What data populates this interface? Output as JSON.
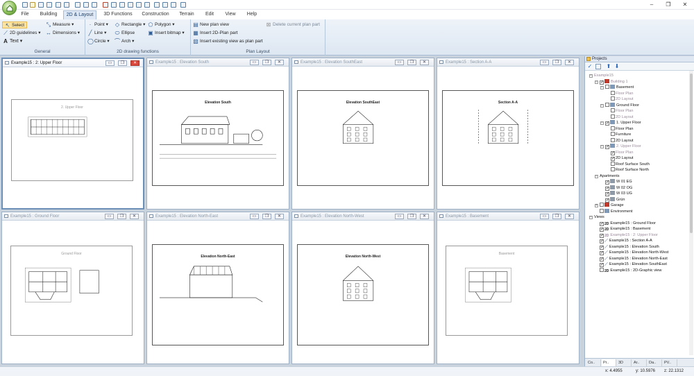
{
  "app": {
    "quick_access_icons": [
      "logo-icon",
      "new-icon",
      "open-icon",
      "save-icon",
      "undo-icon",
      "redo-icon",
      "2d-view-icon",
      "3d-view-icon",
      "paste-icon",
      "copy-icon",
      "print-icon",
      "tools-icon"
    ],
    "window_controls": {
      "minimize": "–",
      "restore": "❐",
      "close": "✕"
    }
  },
  "tabs": [
    "File",
    "Building",
    "2D & Layout",
    "3D Functions",
    "Construction",
    "Terrain",
    "Edit",
    "View",
    "Help"
  ],
  "active_tab": "2D & Layout",
  "ribbon": {
    "general": {
      "label": "General",
      "select": "Select",
      "guidelines": "2D guidelines",
      "text": "Text",
      "measure": "Measure",
      "dimensions": "Dimensions"
    },
    "drawing": {
      "label": "2D drawing functions",
      "point": "Point",
      "line": "Line",
      "circle": "Circle",
      "rectangle": "Rectangle",
      "ellipse": "Ellipse",
      "arch": "Arch",
      "polygon": "Polygon",
      "insert_bitmap": "Insert bitmap"
    },
    "layout": {
      "label": "Plan Layout",
      "new_plan_view": "New plan view",
      "insert_2d_plan_part": "Insert 2D-Plan part",
      "insert_existing_view": "Insert existing view as plan part",
      "delete_plan_part": "Delete current plan part"
    }
  },
  "views": [
    {
      "title": "Example15 : 2: Upper Floor",
      "sheet_title": "2. Upper Floor",
      "kind": "plan"
    },
    {
      "title": "Example15 : Elevation South",
      "sheet_title": "Elevation South",
      "kind": "south"
    },
    {
      "title": "Example15 : Elevation SouthEast",
      "sheet_title": "Elevation SouthEast",
      "kind": "southeast"
    },
    {
      "title": "Example15 : Section A-A",
      "sheet_title": "Section A-A",
      "kind": "section"
    },
    {
      "title": "Example15 : Ground Floor",
      "sheet_title": "Ground Floor",
      "kind": "groundplan"
    },
    {
      "title": "Example15 : Elevation North-East",
      "sheet_title": "Elevation North-East",
      "kind": "northeast"
    },
    {
      "title": "Example15 : Elevation North-West",
      "sheet_title": "Elevation North-West",
      "kind": "northwest"
    },
    {
      "title": "Example15 : Basement",
      "sheet_title": "Basement",
      "kind": "basement"
    }
  ],
  "view_buttons": {
    "minimize": "▭",
    "restore": "❐",
    "close": "✕"
  },
  "projects_panel": {
    "title": "Projects",
    "tree": [
      {
        "label": "Example15",
        "level": 0,
        "exp": "−",
        "grey": true
      },
      {
        "label": "Building 1",
        "level": 1,
        "exp": "−",
        "cb": "✓",
        "icon": "house",
        "grey": true
      },
      {
        "label": "Basement",
        "level": 2,
        "exp": "−",
        "cb": "",
        "icon": "level"
      },
      {
        "label": "Floor Plan",
        "level": 3,
        "cb": "",
        "grey": true
      },
      {
        "label": "2D Layout",
        "level": 3,
        "cb": "",
        "grey": true
      },
      {
        "label": "Ground Floor",
        "level": 2,
        "exp": "−",
        "cb": "",
        "icon": "level"
      },
      {
        "label": "Floor Plan",
        "level": 3,
        "cb": "",
        "grey": true
      },
      {
        "label": "2D Layout",
        "level": 3,
        "cb": "",
        "grey": true
      },
      {
        "label": "1. Upper Floor",
        "level": 2,
        "exp": "−",
        "cb": "✓",
        "icon": "level"
      },
      {
        "label": "Floor Plan",
        "level": 3,
        "cb": ""
      },
      {
        "label": "Furniture",
        "level": 3,
        "cb": ""
      },
      {
        "label": "2D Layout",
        "level": 3,
        "cb": ""
      },
      {
        "label": "2. Upper Floor",
        "level": 2,
        "exp": "−",
        "cb": "✓",
        "icon": "level",
        "grey": true
      },
      {
        "label": "Floor Plan",
        "level": 3,
        "cb": "✓",
        "grey": true
      },
      {
        "label": "2D Layout",
        "level": 3,
        "cb": "✓"
      },
      {
        "label": "Roof Surface South",
        "level": 3,
        "cb": ""
      },
      {
        "label": "Roof Surface North",
        "level": 3,
        "cb": ""
      },
      {
        "label": "Apartments",
        "level": 1,
        "exp": "−"
      },
      {
        "label": "W 01 EG",
        "level": 2,
        "cb": "✓",
        "icon": "apt"
      },
      {
        "label": "W 02 OG",
        "level": 2,
        "cb": "✓",
        "icon": "apt"
      },
      {
        "label": "W 03 UG",
        "level": 2,
        "cb": "✓",
        "icon": "apt"
      },
      {
        "label": "Grün",
        "level": 2,
        "cb": "✓",
        "icon": "apt"
      },
      {
        "label": "Garage",
        "level": 1,
        "exp": "+",
        "cb": "",
        "icon": "house"
      },
      {
        "label": "Environment",
        "level": 1,
        "cb": "",
        "icon": "level"
      },
      {
        "label": "Views",
        "level": 0,
        "exp": "−"
      },
      {
        "label": "Example15 : Ground Floor",
        "level": 1,
        "cb": "✓",
        "icon": "2d"
      },
      {
        "label": "Example15 : Basement",
        "level": 1,
        "cb": "✓",
        "icon": "2d"
      },
      {
        "label": "Example15 : 2: Upper Floor",
        "level": 1,
        "cb": "✓",
        "icon": "2d",
        "grey": true
      },
      {
        "label": "Example15 : Section A-A",
        "level": 1,
        "cb": "✓",
        "icon": "elev"
      },
      {
        "label": "Example15 : Elevation South",
        "level": 1,
        "cb": "✓",
        "icon": "elev"
      },
      {
        "label": "Example15 : Elevation North-West",
        "level": 1,
        "cb": "✓",
        "icon": "elev"
      },
      {
        "label": "Example15 : Elevation North-East",
        "level": 1,
        "cb": "✓",
        "icon": "elev"
      },
      {
        "label": "Example15 : Elevation SouthEast",
        "level": 1,
        "cb": "✓",
        "icon": "elev"
      },
      {
        "label": "Example15 : 2D-Graphic view",
        "level": 1,
        "cb": "",
        "icon": "2d"
      }
    ],
    "bottom_tabs": [
      "Co..",
      "Pr..",
      "3D",
      "Ar..",
      "Da..",
      "PV.."
    ]
  },
  "status": {
    "x": "x: 4.4955",
    "y": "y: 10.5976",
    "z": "z: 22.1312"
  },
  "colors": {
    "accent": "#2f5c93",
    "active_tab": "#dfe9f5",
    "selected_tool": "#fbe3a2",
    "close": "#d9463b"
  }
}
